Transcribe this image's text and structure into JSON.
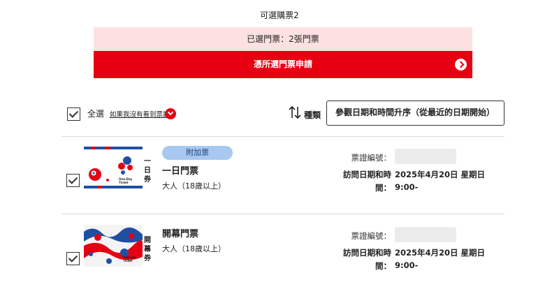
{
  "header": {
    "selectable_label": "可選購票2",
    "selected_summary": "已選門票：2張門票",
    "apply_button_label": "憑所選門票申請"
  },
  "toolbar": {
    "select_all_label": "全選",
    "missing_tickets_link": "如果我沒有看到票證",
    "sort_type_label": "種類",
    "sort_selected": "參觀日期和時間升序（從最近的日期開始）"
  },
  "tickets": [
    {
      "thumb_text": "一日券",
      "thumb_caption": "One-Day Ticket",
      "badge": "附加票",
      "name": "一日門票",
      "type": "大人（18歲以上）",
      "ticket_no_label": "票證編號：",
      "visit_label_line1": "訪問日期和時",
      "visit_label_line2": "間：",
      "visit_date": "2025年4月20日 星期日",
      "visit_time": "9:00-"
    },
    {
      "thumb_text": "開幕券",
      "thumb_caption": "Opening Ticket",
      "badge": "",
      "name": "開幕門票",
      "type": "大人（18歲以上）",
      "ticket_no_label": "票證編號：",
      "visit_label_line1": "訪問日期和時",
      "visit_label_line2": "間：",
      "visit_date": "2025年4月20日 星期日",
      "visit_time": "9:00-"
    }
  ],
  "colors": {
    "brand_red": "#e60012",
    "selected_bg": "#fde1e1",
    "badge_bg": "#a8c8f0"
  }
}
